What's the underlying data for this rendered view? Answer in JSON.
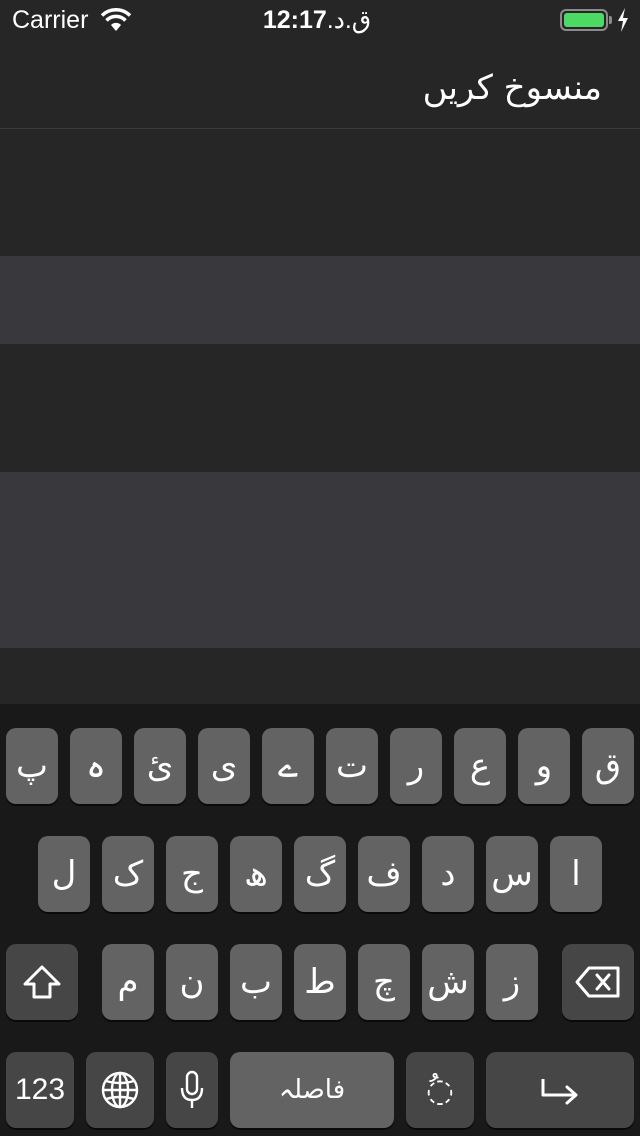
{
  "status_bar": {
    "carrier": "Carrier",
    "time": "12:17",
    "ampm": "ق.د.",
    "battery_color": "#4cd964"
  },
  "nav": {
    "cancel_label": "منسوخ کریں"
  },
  "keyboard": {
    "row1": [
      "پ",
      "ہ",
      "ئ",
      "ی",
      "ے",
      "ت",
      "ر",
      "ع",
      "و",
      "ق"
    ],
    "row2": [
      "ل",
      "ک",
      "ج",
      "ھ",
      "گ",
      "ف",
      "د",
      "س",
      "ا"
    ],
    "row3": [
      "م",
      "ن",
      "ب",
      "ط",
      "چ",
      "ش",
      "ز"
    ],
    "numbers_label": "123",
    "space_label": "فاصلہ",
    "diacritic_label": "◌ُ",
    "icons": [
      "shift-icon",
      "delete-icon",
      "globe-icon",
      "microphone-icon",
      "return-icon"
    ]
  }
}
